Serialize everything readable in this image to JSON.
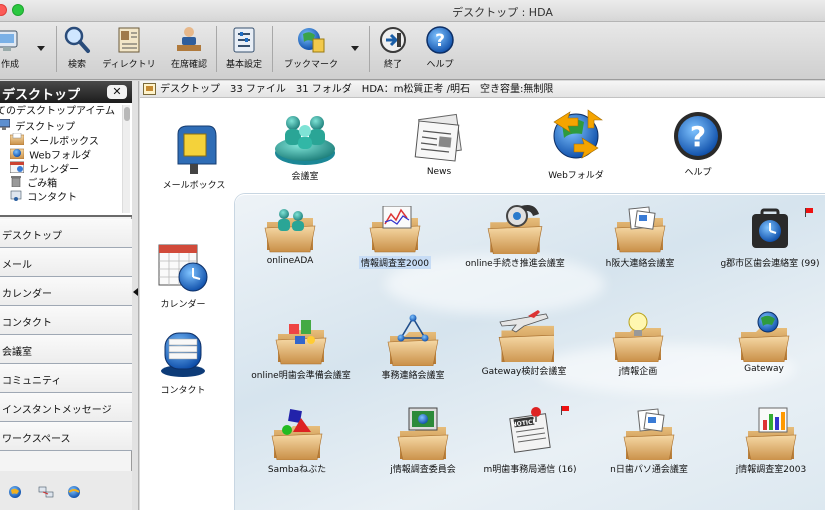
{
  "window": {
    "title": "デスクトップ : HDA"
  },
  "toolbar": {
    "items": [
      {
        "label": "作成",
        "icon": "create-icon"
      },
      {
        "label": "検索",
        "icon": "search-icon"
      },
      {
        "label": "ディレクトリ",
        "icon": "directory-icon"
      },
      {
        "label": "在席確認",
        "icon": "presence-icon"
      },
      {
        "label": "基本設定",
        "icon": "settings-icon"
      },
      {
        "label": "ブックマーク",
        "icon": "bookmark-icon"
      },
      {
        "label": "終了",
        "icon": "quit-icon"
      },
      {
        "label": "ヘルプ",
        "icon": "help-icon"
      }
    ]
  },
  "sidebar": {
    "header": "デスクトップ",
    "close_label": "✕",
    "tree": [
      {
        "label": "てのデスクトップアイテム",
        "icon": "none"
      },
      {
        "label": "デスクトップ",
        "icon": "desktop-icon"
      },
      {
        "label": "メールボックス",
        "icon": "mailbox-icon"
      },
      {
        "label": "Webフォルダ",
        "icon": "web-folder-icon"
      },
      {
        "label": "カレンダー",
        "icon": "calendar-icon"
      },
      {
        "label": "ごみ箱",
        "icon": "trash-icon"
      },
      {
        "label": "コンタクト",
        "icon": "contact-icon"
      }
    ],
    "nav": [
      {
        "label": "デスクトップ"
      },
      {
        "label": "メール"
      },
      {
        "label": "カレンダー"
      },
      {
        "label": "コンタクト"
      },
      {
        "label": "会議室"
      },
      {
        "label": "コミュニティ"
      },
      {
        "label": "インスタントメッセージ"
      },
      {
        "label": "ワークスペース"
      }
    ]
  },
  "status": {
    "summary": "デスクトップ　33 ファイル　31 フォルダ　HDA：m松質正考 /明石",
    "capacity": "空き容量:無制限"
  },
  "desktop": {
    "top_icons": [
      {
        "label": "会議室",
        "icon": "conference-icon"
      },
      {
        "label": "News",
        "icon": "news-icon"
      },
      {
        "label": "Webフォルダ",
        "icon": "web-folder-icon"
      },
      {
        "label": "ヘルプ",
        "icon": "help-icon"
      }
    ],
    "left_icons": [
      {
        "label": "メールボックス",
        "icon": "mailbox-icon"
      },
      {
        "label": "カレンダー",
        "icon": "calendar-icon"
      },
      {
        "label": "コンタクト",
        "icon": "contact-icon"
      }
    ],
    "folders": [
      {
        "label": "onlineADA",
        "icon": "people-folder-icon"
      },
      {
        "label": "情報調査室2000",
        "icon": "chart-folder-icon",
        "selected": true
      },
      {
        "label": "online手続き推進会議室",
        "icon": "phone-folder-icon"
      },
      {
        "label": "h阪大連絡会議室",
        "icon": "document-folder-icon"
      },
      {
        "label": "g郡市区歯会連絡室 (99)",
        "icon": "clock-case-icon",
        "flag": true
      },
      {
        "label": "online明歯会準備会議室",
        "icon": "blocks-folder-icon"
      },
      {
        "label": "事務連絡会議室",
        "icon": "network-folder-icon"
      },
      {
        "label": "Gateway検討会議室",
        "icon": "plane-folder-icon"
      },
      {
        "label": "j情報企画",
        "icon": "bulb-folder-icon"
      },
      {
        "label": "Gateway",
        "icon": "globe-folder-icon"
      },
      {
        "label": "Sambaねぶた",
        "icon": "shapes-folder-icon"
      },
      {
        "label": "j情報調査委員会",
        "icon": "screen-folder-icon"
      },
      {
        "label": "m明歯事務局通信 (16)",
        "icon": "notice-icon",
        "flag": true
      },
      {
        "label": "n日歯パソ通会議室",
        "icon": "document-folder-icon"
      },
      {
        "label": "j情報調査室2003",
        "icon": "chart-folder-icon"
      }
    ]
  },
  "colors": {
    "selection": "#c7dcf5",
    "header_dark": "#1c1c1c",
    "flag": "#e11111"
  }
}
